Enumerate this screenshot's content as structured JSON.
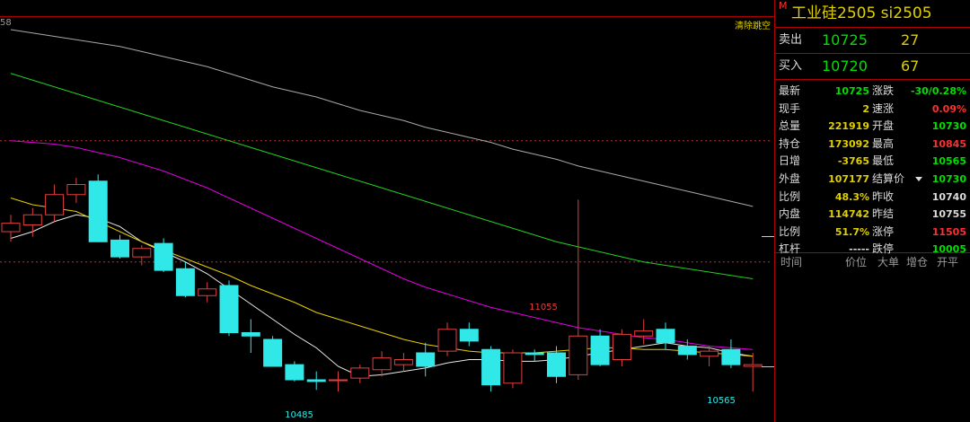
{
  "chart": {
    "top_left_label": "58",
    "corner_label": "清除跳空",
    "high_label": "11055",
    "low_label": "10485",
    "last_low_label": "10565"
  },
  "chart_data": {
    "type": "candlestick",
    "ylim": [
      10400,
      11600
    ],
    "candles": [
      {
        "o": 10960,
        "h": 11010,
        "l": 10930,
        "c": 10985
      },
      {
        "o": 10980,
        "h": 11030,
        "l": 10945,
        "c": 11010
      },
      {
        "o": 11010,
        "h": 11100,
        "l": 10990,
        "c": 11070
      },
      {
        "o": 11070,
        "h": 11120,
        "l": 11045,
        "c": 11100
      },
      {
        "o": 11110,
        "h": 11130,
        "l": 10930,
        "c": 10930
      },
      {
        "o": 10935,
        "h": 10950,
        "l": 10880,
        "c": 10885
      },
      {
        "o": 10885,
        "h": 10920,
        "l": 10860,
        "c": 10910
      },
      {
        "o": 10925,
        "h": 10940,
        "l": 10840,
        "c": 10845
      },
      {
        "o": 10850,
        "h": 10870,
        "l": 10765,
        "c": 10770
      },
      {
        "o": 10770,
        "h": 10810,
        "l": 10750,
        "c": 10790
      },
      {
        "o": 10800,
        "h": 10815,
        "l": 10650,
        "c": 10660
      },
      {
        "o": 10660,
        "h": 10700,
        "l": 10600,
        "c": 10650
      },
      {
        "o": 10640,
        "h": 10650,
        "l": 10560,
        "c": 10560
      },
      {
        "o": 10565,
        "h": 10575,
        "l": 10515,
        "c": 10520
      },
      {
        "o": 10520,
        "h": 10545,
        "l": 10490,
        "c": 10515
      },
      {
        "o": 10520,
        "h": 10545,
        "l": 10485,
        "c": 10520
      },
      {
        "o": 10525,
        "h": 10565,
        "l": 10510,
        "c": 10555
      },
      {
        "o": 10550,
        "h": 10605,
        "l": 10530,
        "c": 10585
      },
      {
        "o": 10565,
        "h": 10600,
        "l": 10545,
        "c": 10580
      },
      {
        "o": 10600,
        "h": 10630,
        "l": 10530,
        "c": 10560
      },
      {
        "o": 10605,
        "h": 10690,
        "l": 10590,
        "c": 10670
      },
      {
        "o": 10670,
        "h": 10690,
        "l": 10620,
        "c": 10635
      },
      {
        "o": 10610,
        "h": 10620,
        "l": 10485,
        "c": 10505
      },
      {
        "o": 10510,
        "h": 10610,
        "l": 10495,
        "c": 10600
      },
      {
        "o": 10600,
        "h": 10610,
        "l": 10575,
        "c": 10595
      },
      {
        "o": 10600,
        "h": 10620,
        "l": 10510,
        "c": 10530
      },
      {
        "o": 10535,
        "h": 11055,
        "l": 10520,
        "c": 10650
      },
      {
        "o": 10650,
        "h": 10670,
        "l": 10560,
        "c": 10565
      },
      {
        "o": 10580,
        "h": 10670,
        "l": 10560,
        "c": 10655
      },
      {
        "o": 10650,
        "h": 10700,
        "l": 10625,
        "c": 10665
      },
      {
        "o": 10670,
        "h": 10690,
        "l": 10610,
        "c": 10630
      },
      {
        "o": 10620,
        "h": 10640,
        "l": 10580,
        "c": 10595
      },
      {
        "o": 10590,
        "h": 10620,
        "l": 10560,
        "c": 10605
      },
      {
        "o": 10610,
        "h": 10640,
        "l": 10555,
        "c": 10565
      },
      {
        "o": 10560,
        "h": 10600,
        "l": 10485,
        "c": 10565
      }
    ],
    "ma_lines": [
      {
        "color": "#e8e8e8",
        "values": [
          10940,
          10960,
          10990,
          11010,
          11000,
          10975,
          10930,
          10900,
          10870,
          10835,
          10790,
          10745,
          10700,
          10655,
          10615,
          10560,
          10530,
          10535,
          10545,
          10555,
          10570,
          10580,
          10580,
          10575,
          10575,
          10580,
          10590,
          10600,
          10610,
          10620,
          10630,
          10620,
          10615,
          10600,
          10590
        ]
      },
      {
        "color": "#e8d000",
        "values": [
          11060,
          11040,
          11030,
          11020,
          10990,
          10960,
          10930,
          10905,
          10880,
          10855,
          10830,
          10800,
          10775,
          10750,
          10720,
          10700,
          10680,
          10660,
          10640,
          10625,
          10615,
          10605,
          10600,
          10600,
          10600,
          10605,
          10610,
          10615,
          10615,
          10610,
          10610,
          10605,
          10600,
          10595,
          10590
        ]
      },
      {
        "color": "#e000e0",
        "values": [
          11230,
          11225,
          11220,
          11210,
          11195,
          11180,
          11160,
          11140,
          11115,
          11090,
          11060,
          11030,
          11000,
          10970,
          10940,
          10910,
          10880,
          10850,
          10820,
          10795,
          10775,
          10755,
          10735,
          10720,
          10705,
          10690,
          10675,
          10665,
          10655,
          10645,
          10640,
          10630,
          10620,
          10615,
          10610
        ]
      },
      {
        "color": "#20d020",
        "values": [
          11430,
          11410,
          11390,
          11370,
          11350,
          11330,
          11310,
          11290,
          11270,
          11250,
          11230,
          11210,
          11190,
          11170,
          11150,
          11130,
          11110,
          11090,
          11070,
          11050,
          11030,
          11010,
          10990,
          10970,
          10950,
          10930,
          10915,
          10900,
          10885,
          10870,
          10860,
          10850,
          10840,
          10830,
          10820
        ]
      },
      {
        "color": "#a8a8a8",
        "values": [
          11560,
          11550,
          11540,
          11530,
          11520,
          11510,
          11495,
          11480,
          11465,
          11450,
          11430,
          11410,
          11390,
          11375,
          11360,
          11340,
          11320,
          11305,
          11290,
          11270,
          11255,
          11240,
          11225,
          11205,
          11190,
          11175,
          11155,
          11140,
          11125,
          11110,
          11095,
          11080,
          11065,
          11050,
          11035
        ]
      }
    ],
    "reference_lines": [
      {
        "value": 11230,
        "color": "#c03030"
      },
      {
        "value": 10870,
        "color": "#c03030"
      }
    ]
  },
  "panel": {
    "m_mark": "M",
    "title": "工业硅2505 si2505",
    "sell": {
      "label": "卖出",
      "price": "10725",
      "volume": "27"
    },
    "buy": {
      "label": "买入",
      "price": "10720",
      "volume": "67"
    },
    "rows": [
      {
        "k1": "最新",
        "v1": "10725",
        "c1": "#00e000",
        "k2": "涨跌",
        "v2": "-30/0.28%",
        "c2": "#00e000"
      },
      {
        "k1": "现手",
        "v1": "2",
        "c1": "#e0d000",
        "k2": "速涨",
        "v2": "0.09%",
        "c2": "#ff3030"
      },
      {
        "k1": "总量",
        "v1": "221919",
        "c1": "#e0d000",
        "k2": "开盘",
        "v2": "10730",
        "c2": "#00e000"
      },
      {
        "k1": "持仓",
        "v1": "173092",
        "c1": "#e0d000",
        "k2": "最高",
        "v2": "10845",
        "c2": "#ff3030"
      },
      {
        "k1": "日增",
        "v1": "-3765",
        "c1": "#e0d000",
        "k2": "最低",
        "v2": "10565",
        "c2": "#00e000"
      },
      {
        "k1": "外盘",
        "v1": "107177",
        "c1": "#e0d000",
        "k2": "结算价",
        "v2": "10730",
        "c2": "#00e000"
      },
      {
        "k1": "比例",
        "v1": "48.3%",
        "c1": "#e0d000",
        "k2": "昨收",
        "v2": "10740",
        "c2": "#dcdcdc"
      },
      {
        "k1": "内盘",
        "v1": "114742",
        "c1": "#e0d000",
        "k2": "昨结",
        "v2": "10755",
        "c2": "#dcdcdc"
      },
      {
        "k1": "比例",
        "v1": "51.7%",
        "c1": "#e0d000",
        "k2": "涨停",
        "v2": "11505",
        "c2": "#ff3030"
      },
      {
        "k1": "杠杆",
        "v1": "-----",
        "c1": "#dcdcdc",
        "k2": "跌停",
        "v2": "10005",
        "c2": "#00e000"
      }
    ],
    "tick_header": {
      "time": "时间",
      "price": "价位",
      "big": "大单",
      "oi": "增仓",
      "open_close": "开平"
    }
  }
}
